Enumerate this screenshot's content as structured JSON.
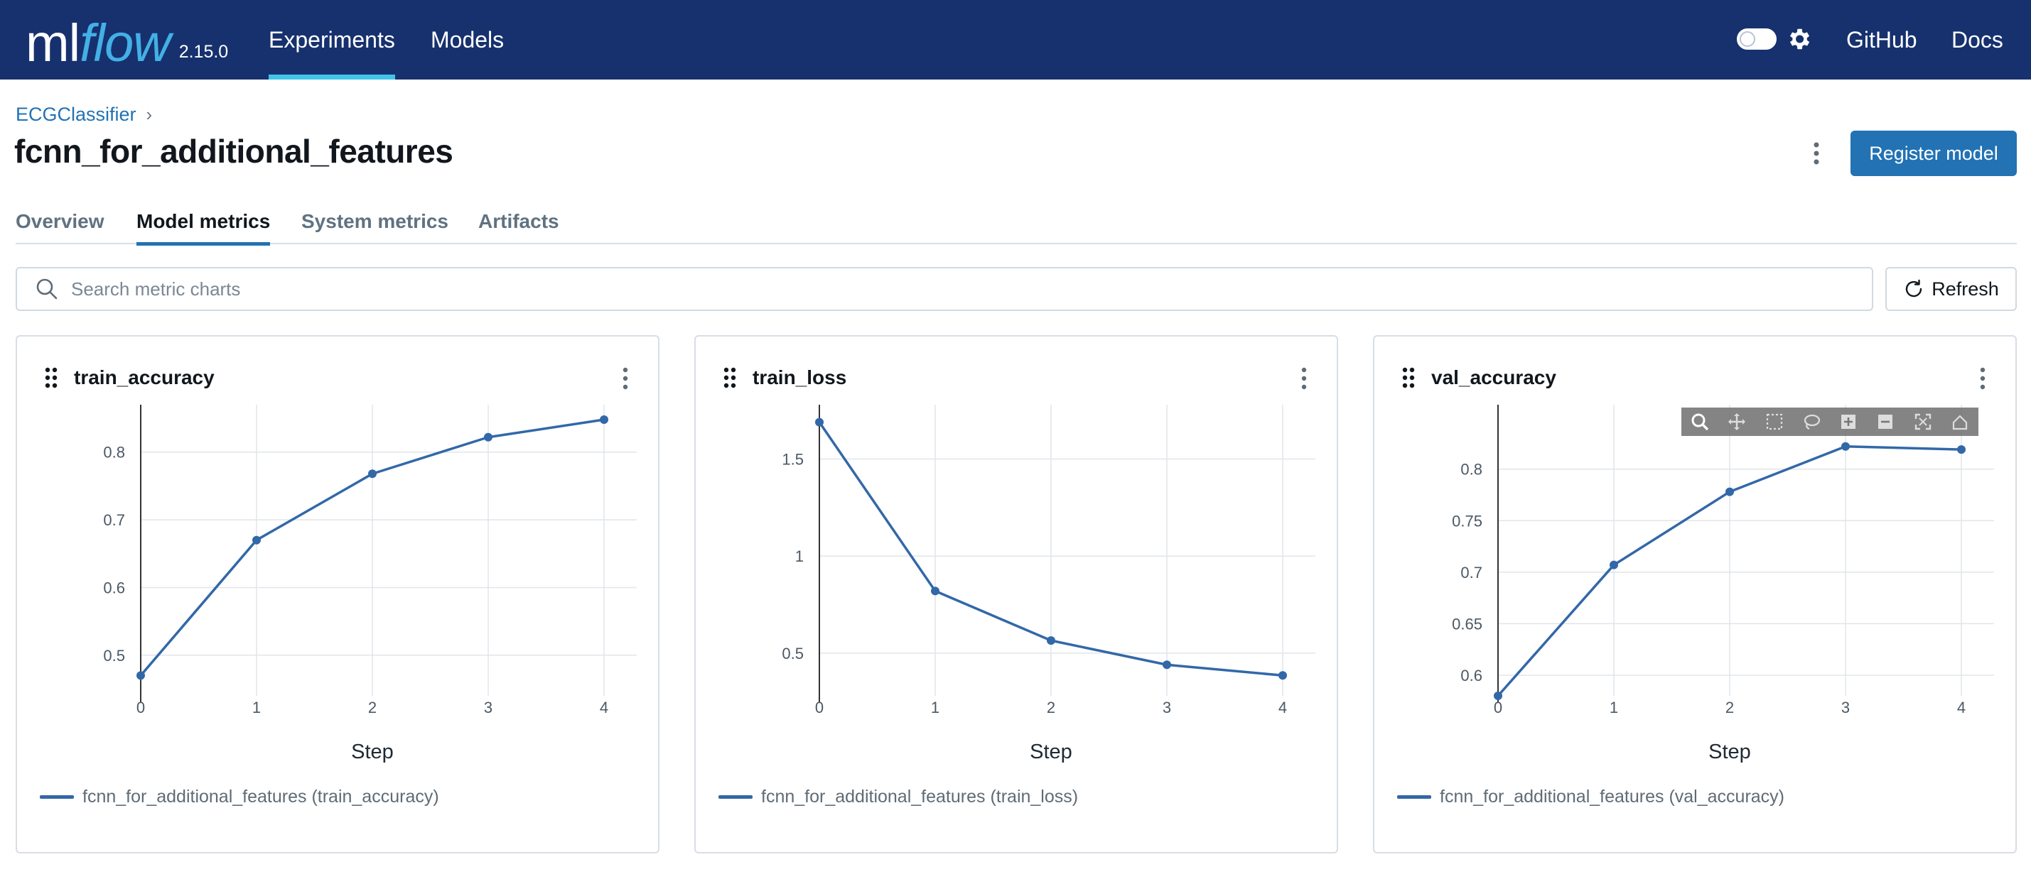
{
  "app": {
    "logo_ml": "ml",
    "logo_flow": "flow",
    "version": "2.15.0",
    "nav": [
      {
        "label": "Experiments",
        "active": true
      },
      {
        "label": "Models",
        "active": false
      }
    ],
    "right_links": [
      "GitHub",
      "Docs"
    ]
  },
  "header": {
    "breadcrumb": "ECGClassifier",
    "title": "fcnn_for_additional_features",
    "register_label": "Register model"
  },
  "tabs": [
    {
      "label": "Overview",
      "active": false
    },
    {
      "label": "Model metrics",
      "active": true
    },
    {
      "label": "System metrics",
      "active": false
    },
    {
      "label": "Artifacts",
      "active": false
    }
  ],
  "search": {
    "placeholder": "Search metric charts",
    "value": ""
  },
  "refresh_label": "Refresh",
  "colors": {
    "topbar": "#16316e",
    "accent": "#2272b4",
    "series": "#3268a8",
    "logo_flow": "#43b0e6"
  },
  "icons": [
    "search-icon",
    "refresh-icon",
    "gear-icon",
    "kebab-icon",
    "drag-handle-icon",
    "zoom-icon",
    "pan-icon",
    "box-select-icon",
    "lasso-icon",
    "zoom-in-icon",
    "zoom-out-icon",
    "autoscale-icon",
    "reset-axes-icon"
  ],
  "cards": [
    {
      "title": "train_accuracy",
      "legend": "fcnn_for_additional_features (train_accuracy)",
      "xlabel": "Step"
    },
    {
      "title": "train_loss",
      "legend": "fcnn_for_additional_features (train_loss)",
      "xlabel": "Step"
    },
    {
      "title": "val_accuracy",
      "legend": "fcnn_for_additional_features (val_accuracy)",
      "xlabel": "Step"
    }
  ],
  "chart_data": [
    {
      "type": "line",
      "title": "train_accuracy",
      "xlabel": "Step",
      "ylabel": "",
      "x": [
        0,
        1,
        2,
        3,
        4
      ],
      "xticks": [
        0,
        1,
        2,
        3,
        4
      ],
      "yticks": [
        0.5,
        0.6,
        0.7,
        0.8
      ],
      "ylim": [
        0.44,
        0.87
      ],
      "series": [
        {
          "name": "fcnn_for_additional_features (train_accuracy)",
          "values": [
            0.47,
            0.67,
            0.768,
            0.822,
            0.848
          ]
        }
      ],
      "grid": true
    },
    {
      "type": "line",
      "title": "train_loss",
      "xlabel": "Step",
      "ylabel": "",
      "x": [
        0,
        1,
        2,
        3,
        4
      ],
      "xticks": [
        0,
        1,
        2,
        3,
        4
      ],
      "yticks": [
        0.5,
        1,
        1.5
      ],
      "ylim": [
        0.28,
        1.78
      ],
      "series": [
        {
          "name": "fcnn_for_additional_features (train_loss)",
          "values": [
            1.69,
            0.82,
            0.565,
            0.44,
            0.385
          ]
        }
      ],
      "grid": true
    },
    {
      "type": "line",
      "title": "val_accuracy",
      "xlabel": "Step",
      "ylabel": "",
      "x": [
        0,
        1,
        2,
        3,
        4
      ],
      "xticks": [
        0,
        1,
        2,
        3,
        4
      ],
      "yticks": [
        0.6,
        0.65,
        0.7,
        0.75,
        0.8
      ],
      "ylim": [
        0.58,
        0.8625
      ],
      "series": [
        {
          "name": "fcnn_for_additional_features (val_accuracy)",
          "values": [
            0.58,
            0.707,
            0.778,
            0.822,
            0.819
          ]
        }
      ],
      "grid": true
    }
  ]
}
